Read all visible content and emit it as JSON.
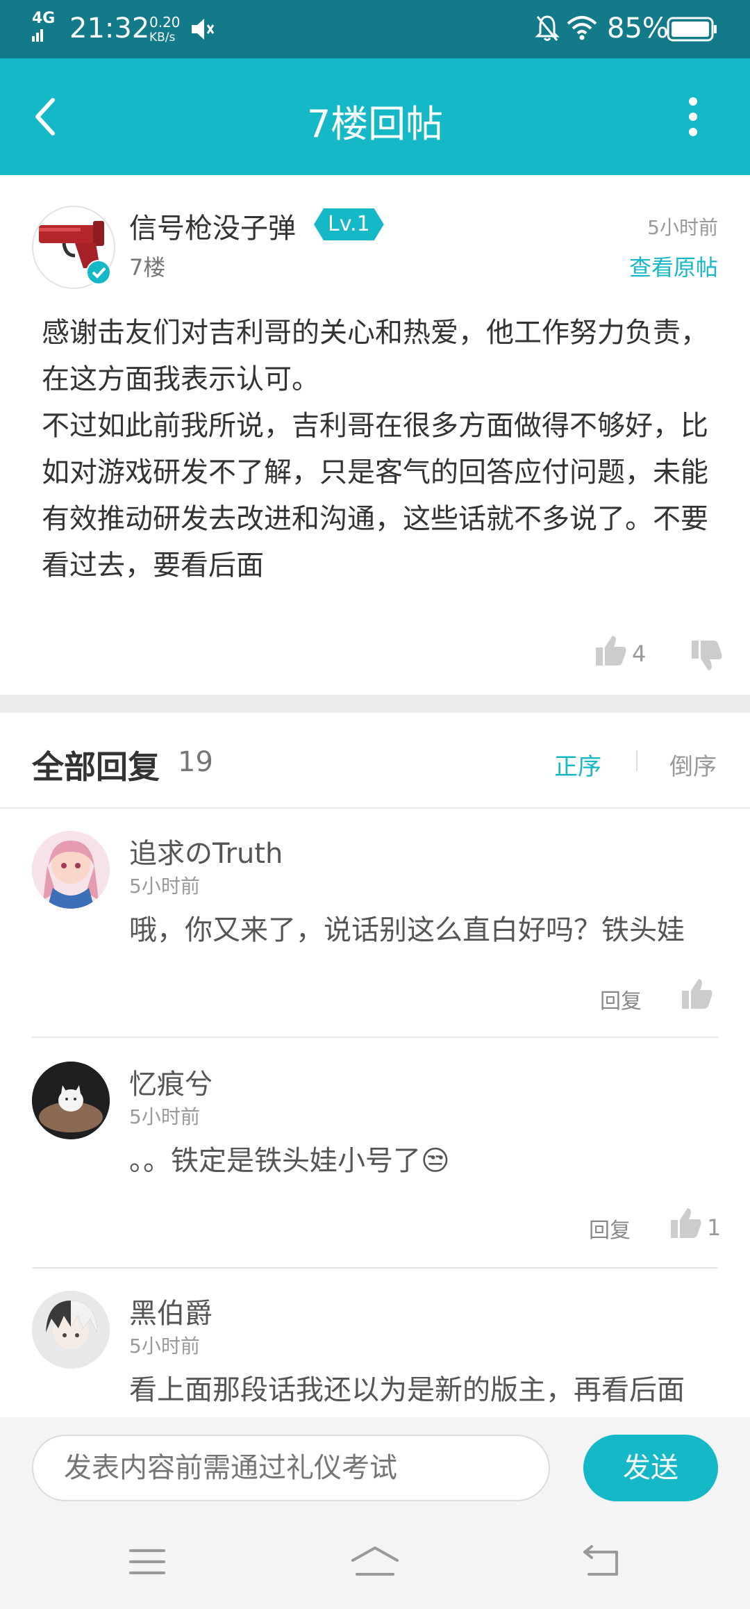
{
  "status_bar": {
    "network": "4G",
    "time": "21:32",
    "speed_value": "0.20",
    "speed_unit": "KB/s",
    "battery": "85%"
  },
  "header": {
    "title": "7楼回帖"
  },
  "post": {
    "username": "信号枪没子弹",
    "level": "Lv.1",
    "floor": "7楼",
    "time": "5小时前",
    "view_original": "查看原帖",
    "paragraphs": [
      "感谢击友们对吉利哥的关心和热爱，他工作努力负责，在这方面我表示认可。",
      "不过如此前我所说，吉利哥在很多方面做得不够好，比如对游戏研发不了解，只是客气的回答应付问题，未能有效推动研发去改进和沟通，这些话就不多说了。不要看过去，要看后面"
    ],
    "like_count": "4"
  },
  "replies_header": {
    "title": "全部回复",
    "count": "19",
    "sort_asc": "正序",
    "sort_desc": "倒序"
  },
  "replies": [
    {
      "name": "追求のTruth",
      "time": "5小时前",
      "text": "哦，你又来了，说话别这么直白好吗？铁头娃",
      "reply_label": "回复",
      "like_count": ""
    },
    {
      "name": "忆痕兮",
      "time": "5小时前",
      "text": "。。铁定是铁头娃小号了😒",
      "reply_label": "回复",
      "like_count": "1"
    },
    {
      "name": "黑伯爵",
      "time": "5小时前",
      "text": "看上面那段话我还以为是新的版主，再看后面",
      "reply_label": "",
      "like_count": ""
    }
  ],
  "composer": {
    "placeholder": "发表内容前需通过礼仪考试",
    "send_label": "发送"
  },
  "colors": {
    "accent": "#15b8c6",
    "status_bar": "#137a8a"
  },
  "icons": [
    "back-arrow-icon",
    "more-vertical-icon",
    "thumbs-up-icon",
    "thumbs-down-icon",
    "verified-check-icon",
    "menu-icon",
    "home-icon",
    "return-icon",
    "mute-icon",
    "wifi-icon",
    "battery-icon",
    "bell-off-icon"
  ]
}
